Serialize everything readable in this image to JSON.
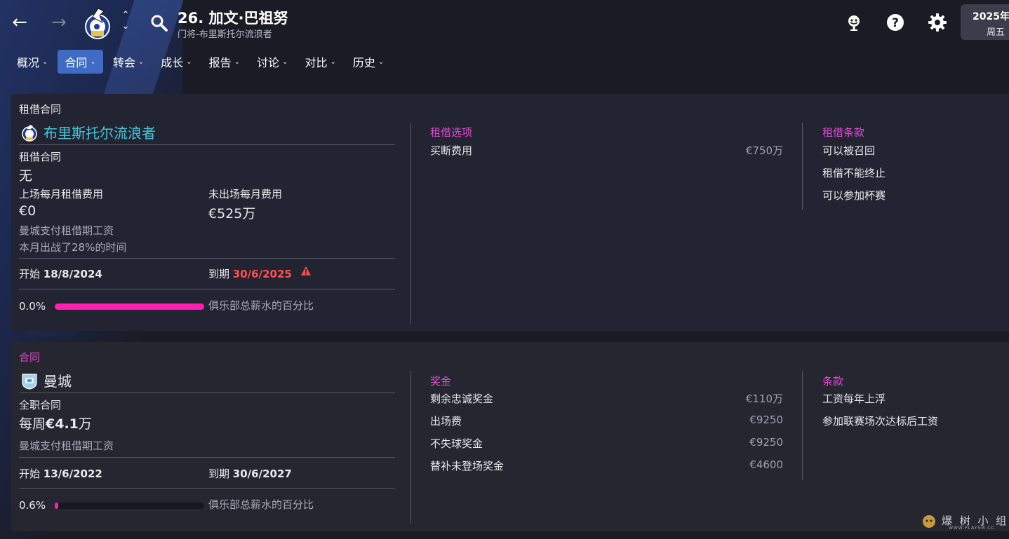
{
  "header": {
    "title": "26. 加文·巴祖努",
    "subtitle": "门将-布里斯托尔流浪者",
    "date_line1": "2025年",
    "date_line2": "周五"
  },
  "tabs": [
    {
      "label": "概况",
      "active": false
    },
    {
      "label": "合同",
      "active": true
    },
    {
      "label": "转会",
      "active": false
    },
    {
      "label": "成长",
      "active": false
    },
    {
      "label": "报告",
      "active": false
    },
    {
      "label": "讨论",
      "active": false
    },
    {
      "label": "对比",
      "active": false
    },
    {
      "label": "历史",
      "active": false
    }
  ],
  "loan": {
    "section_title": "租借合同",
    "club_name": "布里斯托尔流浪者",
    "contract_type_label": "租借合同",
    "contract_type_value": "无",
    "played_fee_label": "上场每月租借费用",
    "played_fee_value": "€0",
    "unplayed_fee_label": "未出场每月费用",
    "unplayed_fee_value": "€525万",
    "wage_note": "曼城支付租借期工资",
    "played_note": "本月出战了28%的时间",
    "start_label": "开始",
    "start_date": "18/8/2024",
    "end_label": "到期",
    "end_date": "30/6/2025",
    "wage_percent": "0.0%",
    "wage_percent_value": 1.0,
    "wage_percent_label": "俱乐部总薪水的百分比",
    "options_title": "租借选项",
    "options": [
      {
        "label": "买断费用",
        "value": "€750万"
      }
    ],
    "clauses_title": "租借条款",
    "clauses": [
      "可以被召回",
      "租借不能终止",
      "可以参加杯赛"
    ]
  },
  "contract": {
    "section_title": "合同",
    "club_name": "曼城",
    "contract_type": "全职合同",
    "wage_prefix": "每周",
    "wage_value": "€4.1",
    "wage_suffix": "万",
    "wage_note": "曼城支付租借期工资",
    "start_label": "开始",
    "start_date": "13/6/2022",
    "end_label": "到期",
    "end_date": "30/6/2027",
    "wage_percent": "0.6%",
    "wage_percent_value": 0.006,
    "wage_percent_label": "俱乐部总薪水的百分比",
    "bonus_title": "奖金",
    "bonuses": [
      {
        "label": "剩余忠诚奖金",
        "value": "€110万"
      },
      {
        "label": "出场费",
        "value": "€9250"
      },
      {
        "label": "不失球奖金",
        "value": "€9250"
      },
      {
        "label": "替补未登场奖金",
        "value": "€4600"
      }
    ],
    "clauses_title": "条款",
    "clauses": [
      "工资每年上浮",
      "参加联赛场次达标后工资"
    ]
  },
  "watermark": {
    "text": "爆 树 小 组",
    "small": "WWW.PLAYSM.CC"
  },
  "colors": {
    "accent": "#3f6bc5",
    "pink": "#e14bd0",
    "bar": "#ff1fb0",
    "teal": "#45c6d6",
    "danger": "#ff5050"
  }
}
